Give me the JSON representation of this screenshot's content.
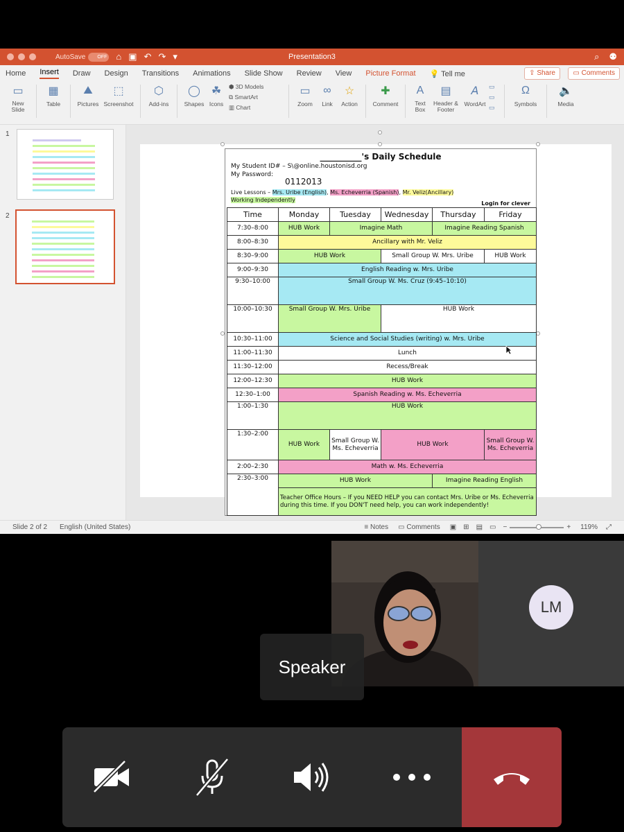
{
  "app": {
    "autosave_label": "AutoSave",
    "autosave_state": "OFF",
    "doc_title": "Presentation3"
  },
  "tabs": [
    "Home",
    "Insert",
    "Draw",
    "Design",
    "Transitions",
    "Animations",
    "Slide Show",
    "Review",
    "View",
    "Picture Format"
  ],
  "tell_me": "Tell me",
  "share_label": "Share",
  "comments_label": "Comments",
  "ribbon": {
    "new_slide": "New\nSlide",
    "table": "Table",
    "pictures": "Pictures",
    "screenshot": "Screenshot",
    "addins": "Add-ins",
    "shapes": "Shapes",
    "icons": "Icons",
    "models3d": "3D Models",
    "smartart": "SmartArt",
    "chart": "Chart",
    "zoom": "Zoom",
    "link": "Link",
    "action": "Action",
    "comment": "Comment",
    "textbox": "Text\nBox",
    "header_footer": "Header &\nFooter",
    "wordart": "WordArt",
    "symbols": "Symbols",
    "media": "Media"
  },
  "thumbnails": [
    {
      "num": "1"
    },
    {
      "num": "2"
    }
  ],
  "status": {
    "slide": "Slide 2 of 2",
    "language": "English (United States)",
    "notes": "Notes",
    "comments": "Comments",
    "zoom": "119%"
  },
  "schedule": {
    "title": "__________'s Daily Schedule",
    "student_id": "My Student ID# – S\\@online.houstonisd.org",
    "password_label": "My Password:",
    "password": "0112013",
    "live_lessons_prefix": "Live Lessons –",
    "live1": "Mrs. Uribe (English)",
    "live2": "Ms. Echeverria (Spanish)",
    "live3": "Mr. Veliz(Ancillary)",
    "working": "Working Independently",
    "login": "Login for clever",
    "headers": [
      "Time",
      "Monday",
      "Tuesday",
      "Wednesday",
      "Thursday",
      "Friday"
    ],
    "rows": {
      "r1": {
        "time": "7:30–8:00",
        "a": "HUB Work",
        "b": "Imagine Math",
        "c": "Imagine Reading Spanish"
      },
      "r2": {
        "time": "8:00–8:30",
        "a": "Ancillary with Mr. Veliz"
      },
      "r3": {
        "time": "8:30–9:00",
        "a": "HUB Work",
        "b": "Small Group W. Mrs. Uribe",
        "c": "HUB Work"
      },
      "r4": {
        "time": "9:00–9:30",
        "a": "English Reading w. Mrs. Uribe"
      },
      "r5": {
        "time": "9:30–10:00",
        "a": "Small Group W. Ms. Cruz (9:45–10:10)"
      },
      "r6": {
        "time": "10:00–10:30",
        "a": "Small Group W. Mrs. Uribe",
        "b": "HUB Work"
      },
      "r7": {
        "time": "10:30–11:00",
        "a": "Science and Social Studies (writing) w. Mrs. Uribe"
      },
      "r8": {
        "time": "11:00–11:30",
        "a": "Lunch"
      },
      "r9": {
        "time": "11:30–12:00",
        "a": "Recess/Break"
      },
      "r10": {
        "time": "12:00–12:30",
        "a": "HUB Work"
      },
      "r11": {
        "time": "12:30–1:00",
        "a": "Spanish Reading w.  Ms. Echeverria"
      },
      "r12": {
        "time": "1:00–1:30",
        "a": "HUB Work"
      },
      "r13": {
        "time": "1:30–2:00",
        "a": "HUB Work",
        "b": "Small Group W. Ms. Echeverria",
        "c": "HUB Work",
        "d": "Small Group W. Ms. Echeverria"
      },
      "r14": {
        "time": "2:00–2:30",
        "a": "Math w. Ms. Echeverria"
      },
      "r15": {
        "time": "2:30–3:00",
        "a": "HUB Work",
        "b": "Imagine Reading English",
        "c": "Teacher Office Hours – If you NEED HELP you can contact Mrs. Uribe or Ms. Echeverria during this time. If you DON'T need help, you can work independently!"
      }
    }
  },
  "meeting": {
    "speaker_label": "Speaker",
    "participant_initials": "LM"
  },
  "colors": {
    "ppt_accent": "#d35230",
    "green": "#c8f7a0",
    "yellow": "#fdfa9a",
    "blue": "#a6e9f3",
    "pink": "#f3a0c7",
    "end_call": "#a4373a"
  }
}
